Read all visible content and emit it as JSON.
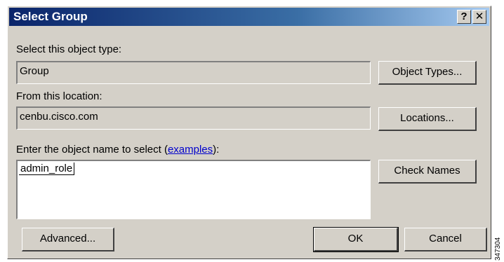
{
  "window": {
    "title": "Select Group",
    "help_button": "?",
    "close_button": "✕"
  },
  "object_type": {
    "label": "Select this object type:",
    "value": "Group",
    "button": "Object Types..."
  },
  "location": {
    "label": "From this location:",
    "value": "cenbu.cisco.com",
    "button": "Locations..."
  },
  "object_name": {
    "label_prefix": "Enter the object name to select (",
    "label_link": "examples",
    "label_suffix": "):",
    "value": "admin_role",
    "button": "Check Names"
  },
  "footer": {
    "advanced_button": "Advanced...",
    "ok_button": "OK",
    "cancel_button": "Cancel"
  },
  "figure_id": "347304"
}
